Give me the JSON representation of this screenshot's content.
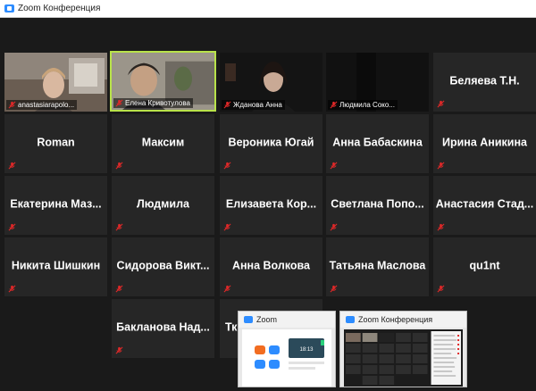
{
  "window": {
    "title": "Zoom Конференция"
  },
  "tiles": [
    {
      "name": "anastasiarapolo...",
      "kind": "video"
    },
    {
      "name": "Елена Кривотулова",
      "kind": "video",
      "active": true
    },
    {
      "name": "Жданова Анна",
      "kind": "video"
    },
    {
      "name": "Людмила Соко...",
      "kind": "video-off"
    },
    {
      "name": "Беляева Т.Н.",
      "kind": "name"
    },
    {
      "name": "Roman",
      "kind": "name"
    },
    {
      "name": "Максим",
      "kind": "name"
    },
    {
      "name": "Вероника Югай",
      "kind": "name"
    },
    {
      "name": "Анна Бабаскина",
      "kind": "name"
    },
    {
      "name": "Ирина Аникина",
      "kind": "name"
    },
    {
      "name": "Екатерина  Маз...",
      "kind": "name"
    },
    {
      "name": "Людмила",
      "kind": "name"
    },
    {
      "name": "Елизавета  Кор...",
      "kind": "name"
    },
    {
      "name": "Светлана  Попо...",
      "kind": "name"
    },
    {
      "name": "Анастасия  Стад...",
      "kind": "name"
    },
    {
      "name": "Никита Шишкин",
      "kind": "name"
    },
    {
      "name": "Сидорова  Викт...",
      "kind": "name"
    },
    {
      "name": "Анна Волкова",
      "kind": "name"
    },
    {
      "name": "Татьяна Маслова",
      "kind": "name"
    },
    {
      "name": "qu1nt",
      "kind": "name"
    },
    {
      "name": "Бакланова  Над...",
      "kind": "name"
    },
    {
      "name": "Тк",
      "kind": "name"
    }
  ],
  "taskbar_previews": [
    {
      "title": "Zoom",
      "clock": "18:13"
    },
    {
      "title": "Zoom Конференция"
    }
  ],
  "colors": {
    "muted_mic": "#e02828",
    "active_speaker": "#b9e34a",
    "tile_bg": "#262626"
  },
  "icons": {
    "mic": "muted-mic-icon"
  }
}
